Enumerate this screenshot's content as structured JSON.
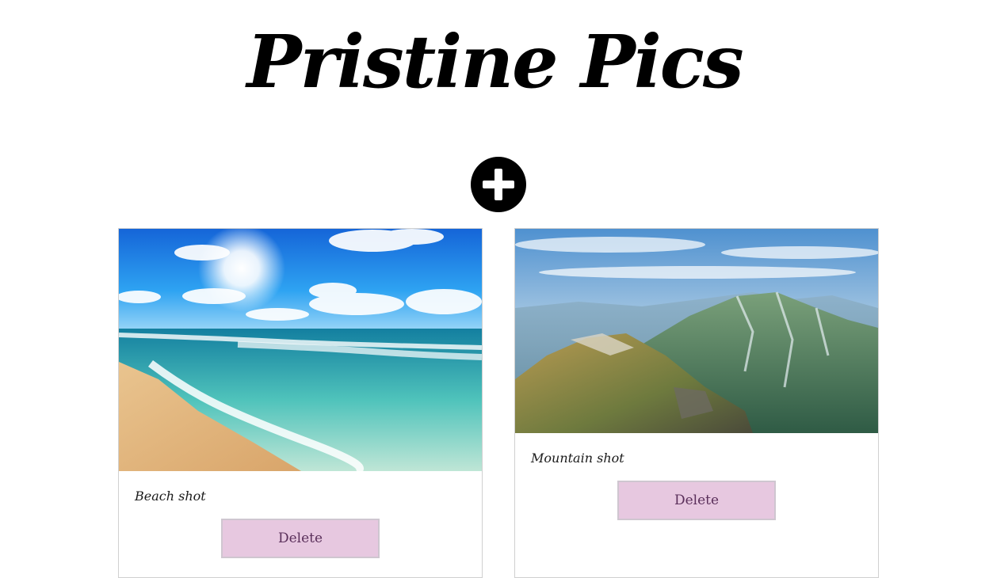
{
  "header": {
    "title": "Pristine Pics"
  },
  "add_button": {
    "icon": "plus-icon"
  },
  "cards": [
    {
      "caption": "Beach shot",
      "delete_label": "Delete",
      "image": "beach-photo"
    },
    {
      "caption": "Mountain shot",
      "delete_label": "Delete",
      "image": "mountain-photo"
    }
  ],
  "colors": {
    "delete_bg": "#e7c8e0",
    "delete_text": "#5a2f5a",
    "add_bg": "#000000"
  }
}
